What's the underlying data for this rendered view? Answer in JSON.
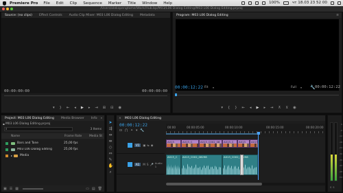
{
  "menubar": {
    "app_name": "Premiere Pro",
    "items": [
      "File",
      "Edit",
      "Clip",
      "Sequence",
      "Marker",
      "Title",
      "Window",
      "Help"
    ],
    "battery": "100%",
    "clock": "чт 18.03  23 52 00"
  },
  "window": {
    "title": "/Users/olekspengtome/Work/Hub.bp/M03/L06 Dialog Editing/M03 L06 Dialog Editing.prproj"
  },
  "source_panel": {
    "tabs": [
      "Source: (no clips)",
      "Effect Controls",
      "Audio Clip Mixer: M03 L06 Dialog Editing",
      "Metadata"
    ],
    "timecode_left": "00:00:00:00",
    "timecode_right": "00:00:00:00"
  },
  "program_panel": {
    "tab": "Program: M03 L06 Dialog Editing",
    "timecode_current": "00:00:12:22",
    "fit": "Fit",
    "quality": "Full",
    "timecode_duration": "00:00:12:22"
  },
  "project_panel": {
    "tabs": [
      "Project: M03 L06 Dialog Editing",
      "Media Browser",
      "Info"
    ],
    "project_file": "M03 L06 Dialog Editing.prproj",
    "items_count": "3 Items",
    "columns": [
      "Name",
      "Frame Rate",
      "Media St"
    ],
    "rows": [
      {
        "name": "Bars and Tone",
        "rate": "25,00 fps",
        "color": "#2e9e5e"
      },
      {
        "name": "M03 L06 Dialog Editing",
        "rate": "25,00 fps",
        "color": "#2e9e5e"
      },
      {
        "name": "Media",
        "rate": "",
        "color": "#d18a2c"
      }
    ]
  },
  "timeline": {
    "tab": "M03 L06 Dialog Editing",
    "timecode": "00:00:12:22",
    "ruler": [
      "00:00",
      "00:00:05:00",
      "00:00:10:00",
      "00:00:15:00",
      "00:00:20:00"
    ],
    "video_track": "V1",
    "audio_track_name": "Audio 1",
    "audio_track": "A1",
    "video_clips": [
      "A013",
      "A013_C",
      "A013_C002_08",
      "A013_C",
      "A013",
      "A013_C002_08"
    ],
    "audio_clip_labels": [
      "A013_C",
      "A013_C002_08298",
      "A013_C002_08298"
    ]
  },
  "meter_labels": [
    "0",
    "-6",
    "-12",
    "-18",
    "-24",
    "-30",
    "-36",
    "-42",
    "-48",
    "-54"
  ],
  "colors": {
    "accent_blue": "#3aa2e8",
    "video_clip": "#b184c7",
    "audio_clip": "#2f7f86",
    "playhead": "#4aa3ff"
  }
}
